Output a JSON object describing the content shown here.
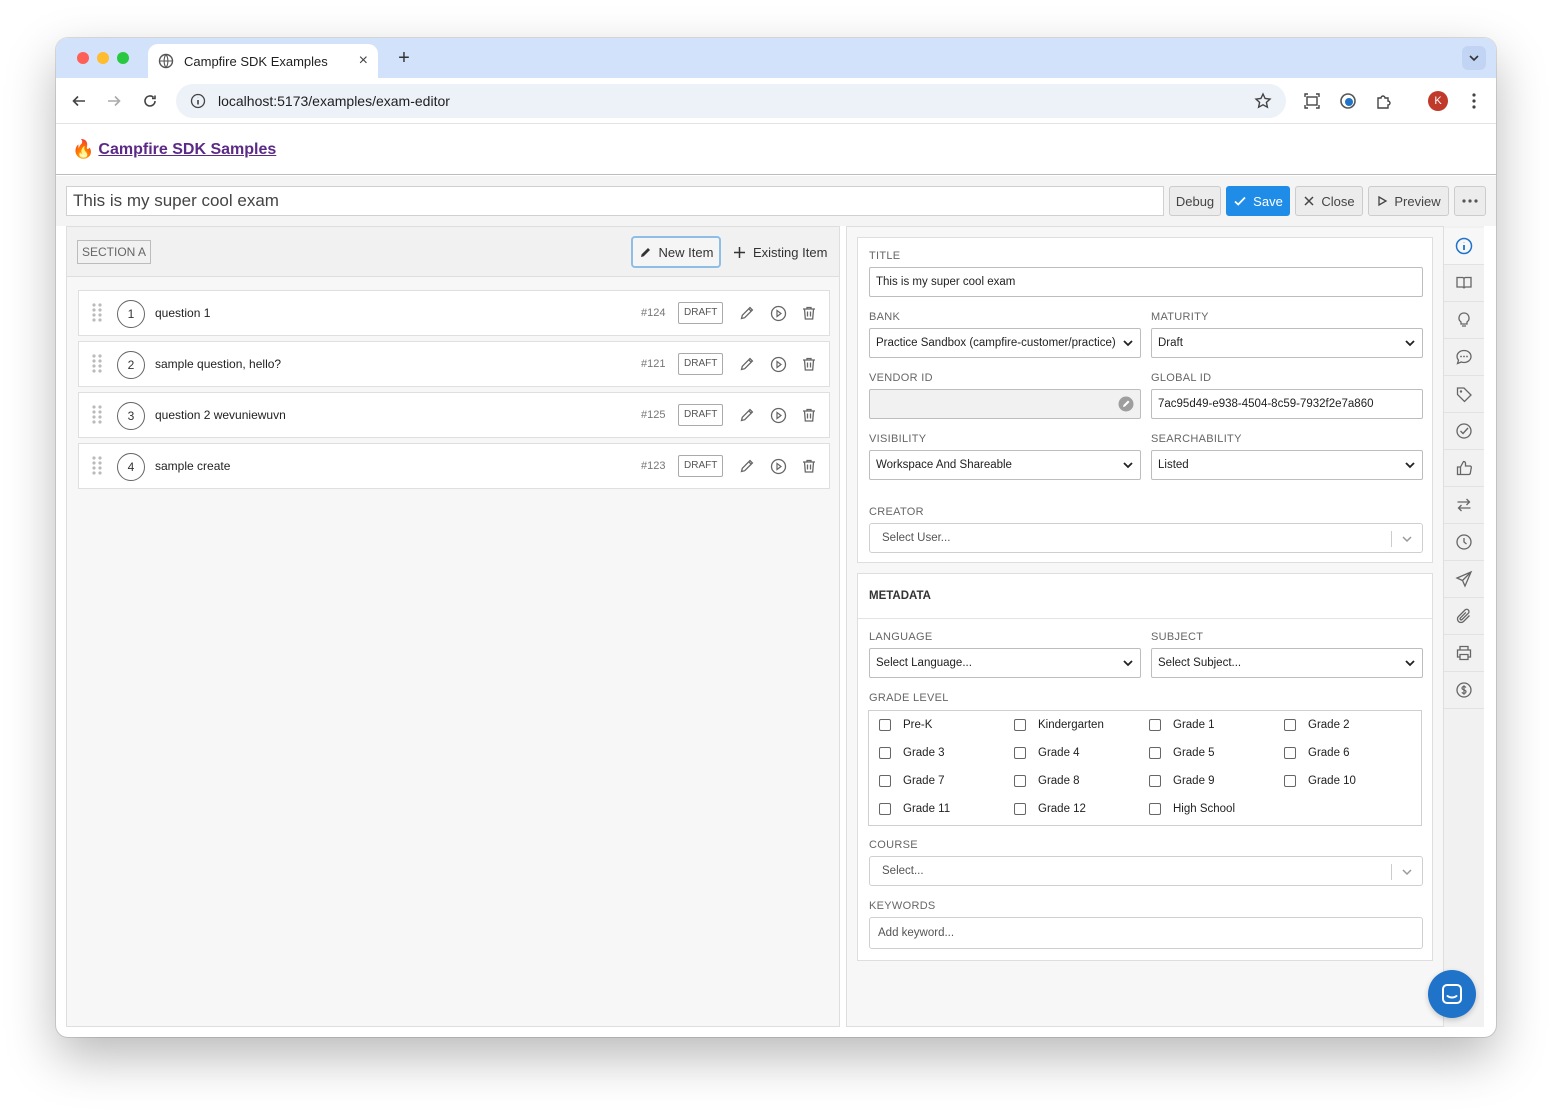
{
  "browser": {
    "tab_title": "Campfire SDK Examples",
    "url": "localhost:5173/examples/exam-editor",
    "profile_initial": "K"
  },
  "app": {
    "brand": "Campfire SDK Samples",
    "brand_icon": "fire-icon"
  },
  "header": {
    "exam_title": "This is my super cool exam",
    "debug_label": "Debug",
    "save_label": "Save",
    "close_label": "Close",
    "preview_label": "Preview"
  },
  "section": {
    "name": "SECTION A",
    "new_item_label": "New Item",
    "existing_item_label": "Existing Item",
    "items": [
      {
        "num": "1",
        "text": "question 1",
        "id": "#124",
        "status": "DRAFT"
      },
      {
        "num": "2",
        "text": "sample question, hello?",
        "id": "#121",
        "status": "DRAFT"
      },
      {
        "num": "3",
        "text": "question 2 wevuniewuvn",
        "id": "#125",
        "status": "DRAFT"
      },
      {
        "num": "4",
        "text": "sample create",
        "id": "#123",
        "status": "DRAFT"
      }
    ]
  },
  "details": {
    "title_label": "TITLE",
    "title_value": "This is my super cool exam",
    "bank_label": "BANK",
    "bank_value": "Practice Sandbox (campfire-customer/practice)",
    "maturity_label": "MATURITY",
    "maturity_value": "Draft",
    "vendor_id_label": "VENDOR ID",
    "vendor_id_value": "",
    "global_id_label": "GLOBAL ID",
    "global_id_value": "7ac95d49-e938-4504-8c59-7932f2e7a860",
    "visibility_label": "VISIBILITY",
    "visibility_value": "Workspace And Shareable",
    "searchability_label": "SEARCHABILITY",
    "searchability_value": "Listed",
    "creator_label": "CREATOR",
    "creator_placeholder": "Select User..."
  },
  "metadata": {
    "heading": "METADATA",
    "language_label": "LANGUAGE",
    "language_value": "Select Language...",
    "subject_label": "SUBJECT",
    "subject_value": "Select Subject...",
    "grade_level_label": "GRADE LEVEL",
    "grades": [
      "Pre-K",
      "Kindergarten",
      "Grade 1",
      "Grade 2",
      "Grade 3",
      "Grade 4",
      "Grade 5",
      "Grade 6",
      "Grade 7",
      "Grade 8",
      "Grade 9",
      "Grade 10",
      "Grade 11",
      "Grade 12",
      "High School"
    ],
    "course_label": "COURSE",
    "course_placeholder": "Select...",
    "keywords_label": "KEYWORDS",
    "keywords_placeholder": "Add keyword..."
  },
  "rail_icons": [
    "info-icon",
    "book-icon",
    "lightbulb-icon",
    "chat-icon",
    "tag-icon",
    "check-circle-icon",
    "thumbs-up-icon",
    "swap-icon",
    "clock-icon",
    "send-icon",
    "paperclip-icon",
    "printer-icon",
    "dollar-icon"
  ],
  "colors": {
    "accent": "#1f8de8",
    "brand_link": "#5b2a86",
    "chat_button": "#1f73c8"
  }
}
